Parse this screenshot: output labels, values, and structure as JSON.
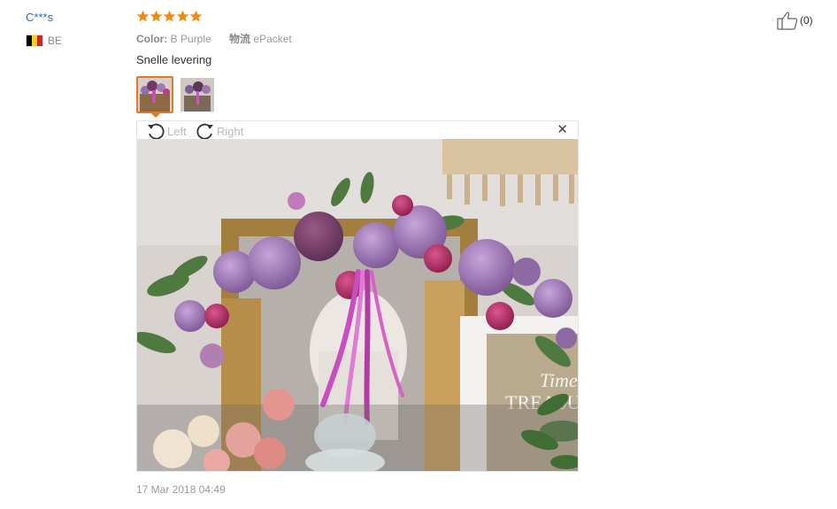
{
  "review": {
    "user": "C***s",
    "country_code": "BE",
    "flag_colors": [
      "#000000",
      "#f7d117",
      "#d6241e"
    ],
    "rating": 5,
    "rating_color": "#f08a12",
    "attributes": [
      {
        "key": "Color:",
        "value": "B Purple"
      },
      {
        "key": "物流",
        "value": "ePacket"
      }
    ],
    "feedback": "Snelle levering",
    "thumbnail_count": 2,
    "active_thumbnail": 1,
    "viewer": {
      "rotate_left_label": "Left",
      "rotate_right_label": "Right",
      "close_icon": "close-icon",
      "photo_text": "TREASU",
      "photo_text_top": "Time"
    },
    "helpful_count": "(0)",
    "date": "17 Mar 2018 04:49"
  }
}
